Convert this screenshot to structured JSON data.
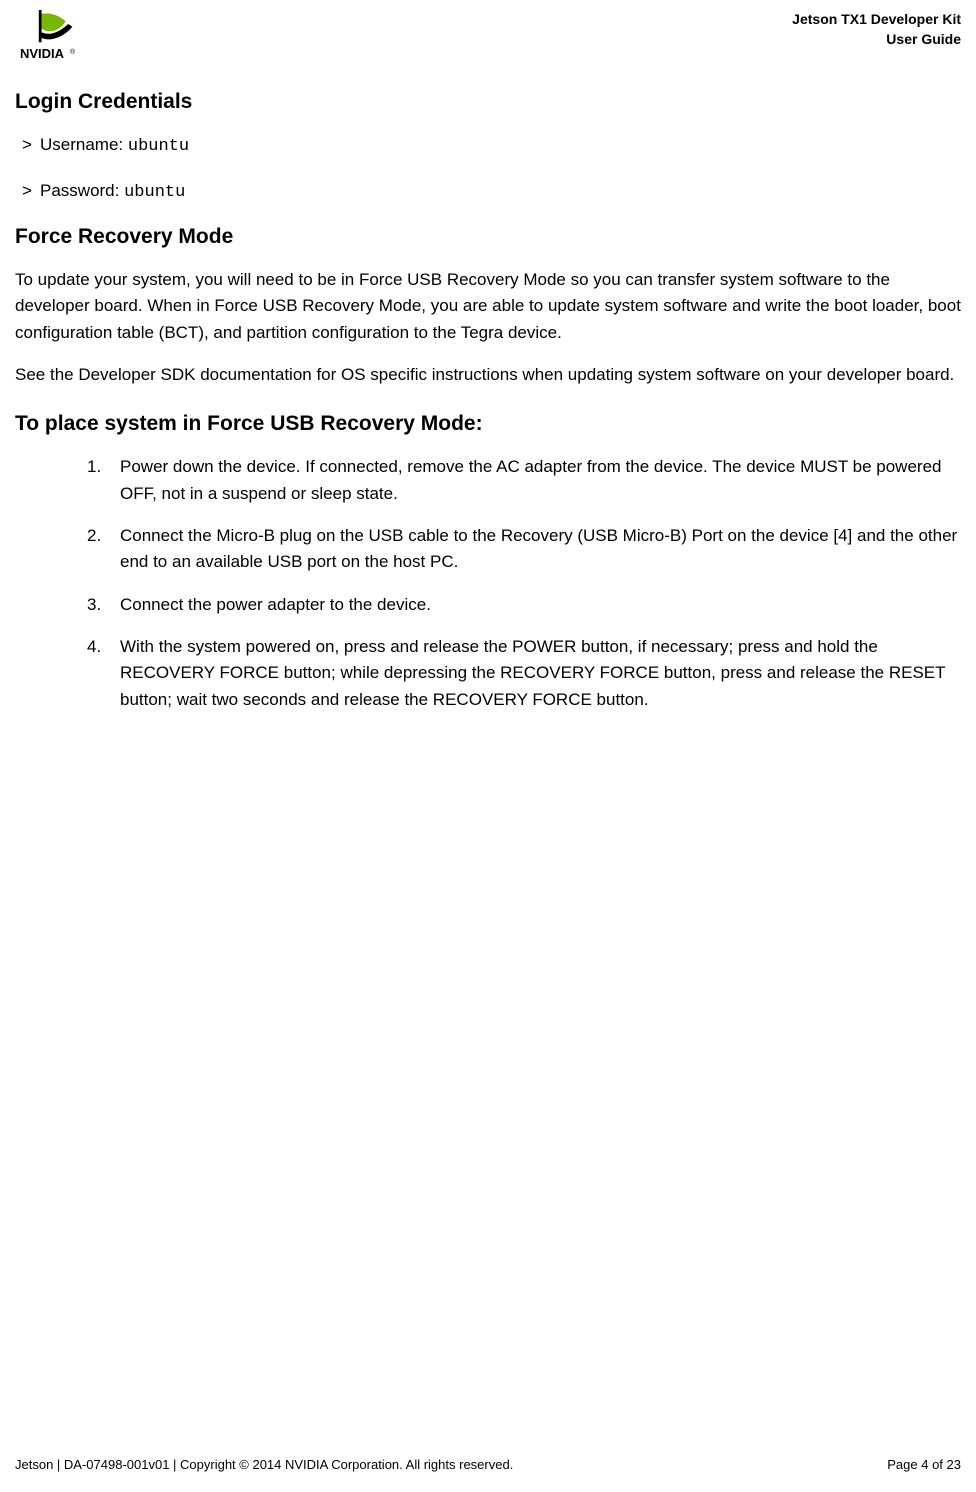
{
  "header": {
    "title_line1": "Jetson TX1 Developer Kit",
    "title_line2": "User Guide"
  },
  "sections": {
    "login_credentials": {
      "heading": "Login Credentials",
      "username_label": "Username: ",
      "username_value": "ubuntu",
      "password_label": "Password: ",
      "password_value": "ubuntu"
    },
    "force_recovery": {
      "heading": "Force Recovery Mode",
      "p1": "To update your system, you will need to be in Force USB Recovery Mode so you can transfer system software to the developer board. When in Force USB Recovery Mode, you are able to update system software and write the boot loader, boot configuration table (BCT), and partition configuration to the Tegra device.",
      "p2": "See the Developer SDK documentation for OS specific instructions when updating system software on your developer board."
    },
    "recovery_steps": {
      "heading": "To place system in Force USB Recovery Mode:",
      "steps": [
        "Power down the device. If connected, remove the AC adapter from the device. The device MUST be powered OFF, not in a suspend or sleep state.",
        "Connect the Micro-B plug on the USB cable to the Recovery (USB Micro-B) Port on the device [4] and the other end to an available USB port on the host PC.",
        "Connect the power adapter to the device.",
        "With the system powered on, press and release the POWER button, if necessary; press and hold the RECOVERY FORCE button; while depressing the RECOVERY FORCE button, press and release the RESET button; wait two seconds and release the RECOVERY FORCE button."
      ]
    }
  },
  "footer": {
    "left": "Jetson | DA-07498-001v01 | Copyright © 2014 NVIDIA Corporation. All rights reserved.",
    "right": "Page 4 of 23"
  }
}
